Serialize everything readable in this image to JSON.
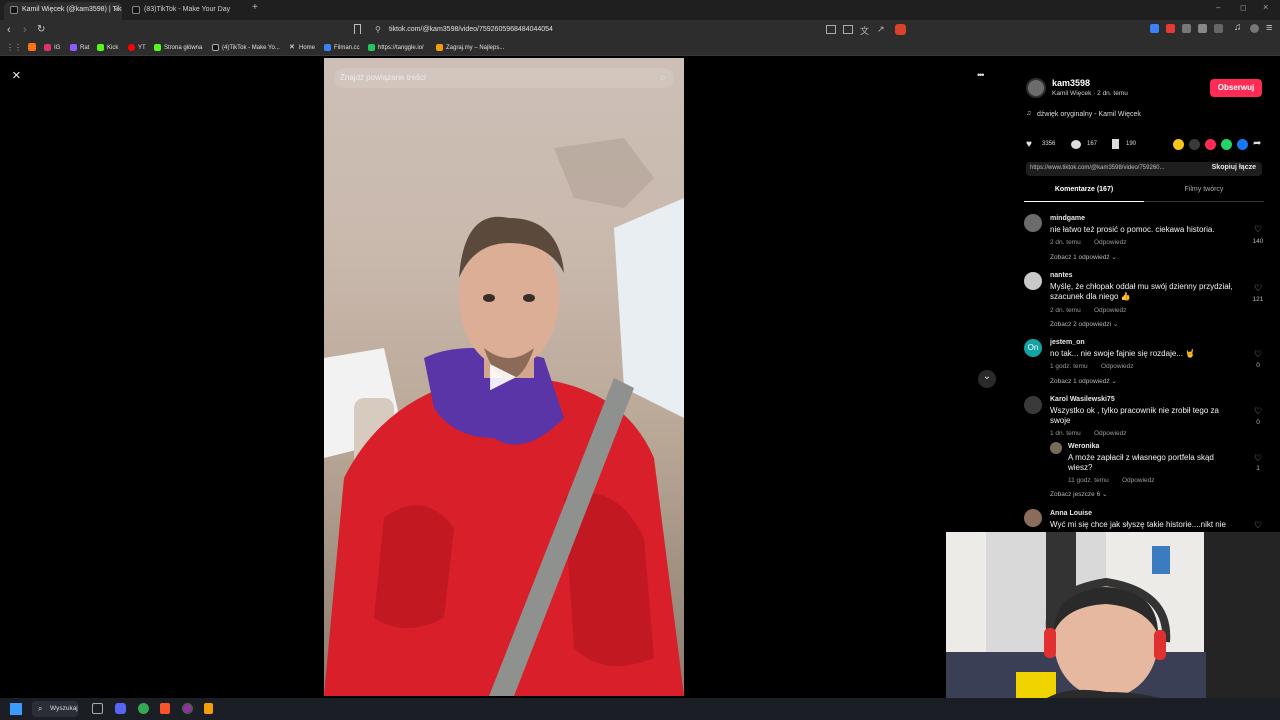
{
  "browser": {
    "tabs": [
      {
        "title": "Kamil Więcek (@kam3598) | Tik",
        "close": "×"
      },
      {
        "title": "(83)TikTok - Make Your Day"
      }
    ],
    "new_tab": "+",
    "window_controls": [
      "–",
      "◻",
      "×"
    ],
    "url": "tiktok.com/@kam3598/video/7592605968484044054",
    "bookmarks": [
      {
        "label": "IG",
        "color": "#e1306c"
      },
      {
        "label": "Rat",
        "color": "#8a5cff"
      },
      {
        "label": "Kick",
        "color": "#53fc18"
      },
      {
        "label": "YT",
        "color": "#ff0000"
      },
      {
        "label": "Strona główna",
        "color": "#53fc18"
      },
      {
        "label": "(4)TikTok - Make Yo...",
        "color": "#ffffff"
      },
      {
        "label": "Home",
        "color": "#ffffff"
      },
      {
        "label": "Filman.cc",
        "color": "#3b82f6"
      },
      {
        "label": "https://tanggle.io/",
        "color": "#22c55e"
      },
      {
        "label": "Zagraj.my – Najleps...",
        "color": "#f59e0b"
      }
    ]
  },
  "video": {
    "search_placeholder": "Znajdź powiązane treści"
  },
  "author": {
    "handle": "kam3598",
    "display": "Kamil Więcek · 2 dn. temu",
    "follow_label": "Obserwuj",
    "sound": "dźwięk oryginalny - Kamil Więcek"
  },
  "stats": {
    "likes": "3356",
    "comments": "167",
    "saves": "190"
  },
  "share": {
    "link": "https://www.tiktok.com/@kam3598/video/759260...",
    "copy_label": "Skopiuj łącze"
  },
  "tabs": {
    "comments": "Komentarze (167)",
    "creator_videos": "Filmy twórcy"
  },
  "comments": [
    {
      "name": "mindgame",
      "text": "nie łatwo też prosić o pomoc. ciekawa historia.",
      "time": "2 dn. temu",
      "reply": "Odpowiedz",
      "more": "Zobacz 1 odpowiedź ⌄",
      "likes": "140",
      "avatar_color": "#6b6b6b"
    },
    {
      "name": "nantes",
      "text": "Myślę, że chłopak oddał mu swój dzienny przydział, szacunek dla niego 👍",
      "time": "2 dn. temu",
      "reply": "Odpowiedz",
      "more": "Zobacz 2 odpowiedzi ⌄",
      "likes": "121",
      "avatar_color": "#c9c9c9"
    },
    {
      "name": "jestem_on",
      "text": "no tak... nie swoje fajnie się rozdaje... 🤘",
      "time": "1 godz. temu",
      "reply": "Odpowiedz",
      "more": "Zobacz 1 odpowiedź ⌄",
      "likes": "0",
      "avatar_color": "#14a3a3",
      "avatar_text": "On"
    },
    {
      "name": "Karol Wasilewski75",
      "text": "Wszystko ok , tylko pracownik nie zrobił tego za swoje",
      "time": "1 dn. temu",
      "reply": "Odpowiedz",
      "likes": "0",
      "avatar_color": "#3a3a3a"
    },
    {
      "name": "Anna Louise",
      "text": "Wyć mi się chce jak słyszę takie historie....nikt nie",
      "likes": "",
      "avatar_color": "#8b6b5b"
    }
  ],
  "reply": {
    "name": "Weronika",
    "text": "A może zapłacił z własnego portfela skąd wiesz?",
    "time": "11 godz. temu",
    "reply": "Odpowiedz",
    "likes": "1",
    "more": "Zobacz jeszcze 6 ⌄"
  },
  "taskbar": {
    "search_label": "Wyszukaj"
  },
  "icons": {
    "close": "×",
    "more": "•••",
    "down": "⌄",
    "play": "▶",
    "heart": "♡",
    "note": "♫",
    "search": "⌕",
    "windows": "⊞"
  }
}
